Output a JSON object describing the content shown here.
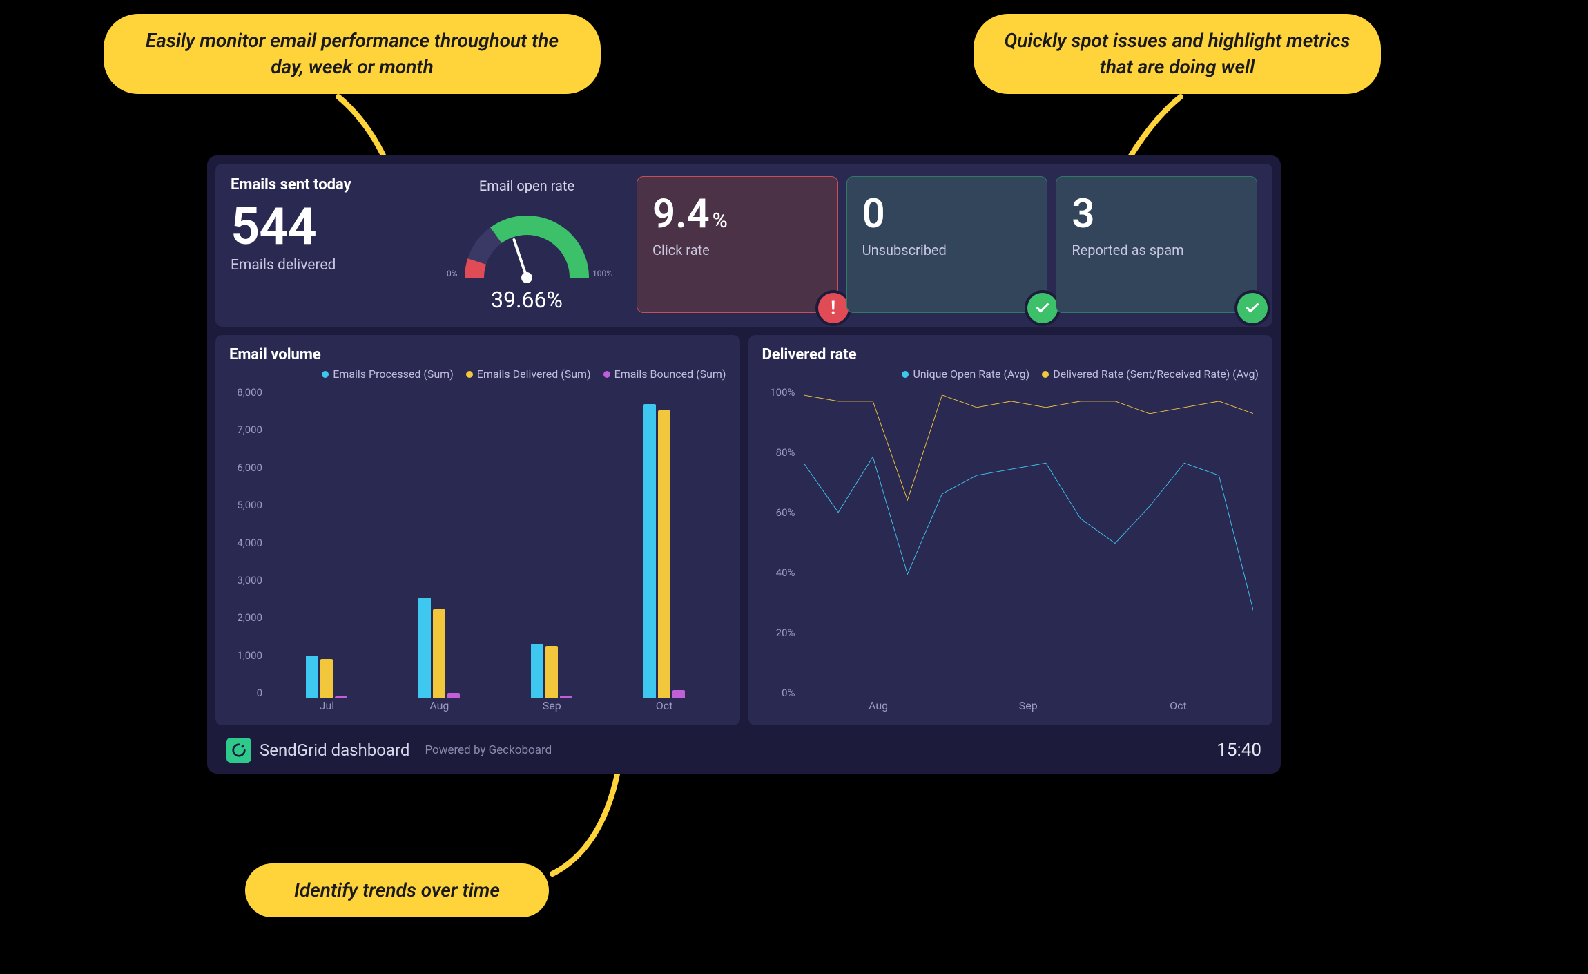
{
  "annotations": {
    "top_left": "Easily monitor email performance throughout\nthe day, week or month",
    "top_right": "Quickly spot issues and highlight\nmetrics that are doing well",
    "bottom": "Identify trends over time"
  },
  "topbar": {
    "section_title": "Emails sent today",
    "delivered_value": "544",
    "delivered_label": "Emails delivered",
    "gauge": {
      "title": "Email open rate",
      "percent_label": "39.66%",
      "min_label": "0%",
      "max_label": "100%",
      "value": 39.66
    },
    "cards": [
      {
        "value": "9.4",
        "unit": "%",
        "label": "Click rate",
        "status": "warn"
      },
      {
        "value": "0",
        "unit": "",
        "label": "Unsubscribed",
        "status": "ok"
      },
      {
        "value": "3",
        "unit": "",
        "label": "Reported as spam",
        "status": "ok"
      }
    ]
  },
  "footer": {
    "title": "SendGrid dashboard",
    "powered_by": "Powered by Geckoboard",
    "time": "15:40"
  },
  "colors": {
    "cyan": "#3fc8ef",
    "yellow": "#f3c73b",
    "magenta": "#c15fd9",
    "green": "#3cc06a",
    "red": "#e14b55"
  },
  "chart_data": [
    {
      "id": "email_volume",
      "type": "bar",
      "title": "Email volume",
      "ylabel": "",
      "ylim": [
        0,
        8000
      ],
      "yticks": [
        0,
        1000,
        2000,
        3000,
        4000,
        5000,
        6000,
        7000,
        8000
      ],
      "ytick_labels": [
        "0",
        "1,000",
        "2,000",
        "3,000",
        "4,000",
        "5,000",
        "6,000",
        "7,000",
        "8,000"
      ],
      "categories": [
        "Jul",
        "Aug",
        "Sep",
        "Oct"
      ],
      "series": [
        {
          "name": "Emails Processed (Sum)",
          "color": "#3fc8ef",
          "values": [
            1100,
            2600,
            1400,
            7600
          ]
        },
        {
          "name": "Emails Delivered (Sum)",
          "color": "#f3c73b",
          "values": [
            1000,
            2300,
            1350,
            7450
          ]
        },
        {
          "name": "Emails Bounced (Sum)",
          "color": "#c15fd9",
          "values": [
            40,
            120,
            50,
            200
          ]
        }
      ]
    },
    {
      "id": "delivered_rate",
      "type": "line",
      "title": "Delivered rate",
      "ylabel": "",
      "ylim": [
        0,
        100
      ],
      "yticks": [
        0,
        20,
        40,
        60,
        80,
        100
      ],
      "ytick_labels": [
        "0%",
        "20%",
        "40%",
        "60%",
        "80%",
        "100%"
      ],
      "x_labels": [
        "Aug",
        "Sep",
        "Oct"
      ],
      "x_count": 14,
      "series": [
        {
          "name": "Unique Open Rate (Avg)",
          "color": "#3fc8ef",
          "values": [
            76,
            60,
            78,
            40,
            66,
            72,
            74,
            76,
            58,
            50,
            62,
            76,
            72,
            28
          ]
        },
        {
          "name": "Delivered Rate (Sent/Received Rate) (Avg)",
          "color": "#f3c73b",
          "values": [
            98,
            96,
            96,
            64,
            98,
            94,
            96,
            94,
            96,
            96,
            92,
            94,
            96,
            92
          ]
        }
      ]
    }
  ]
}
